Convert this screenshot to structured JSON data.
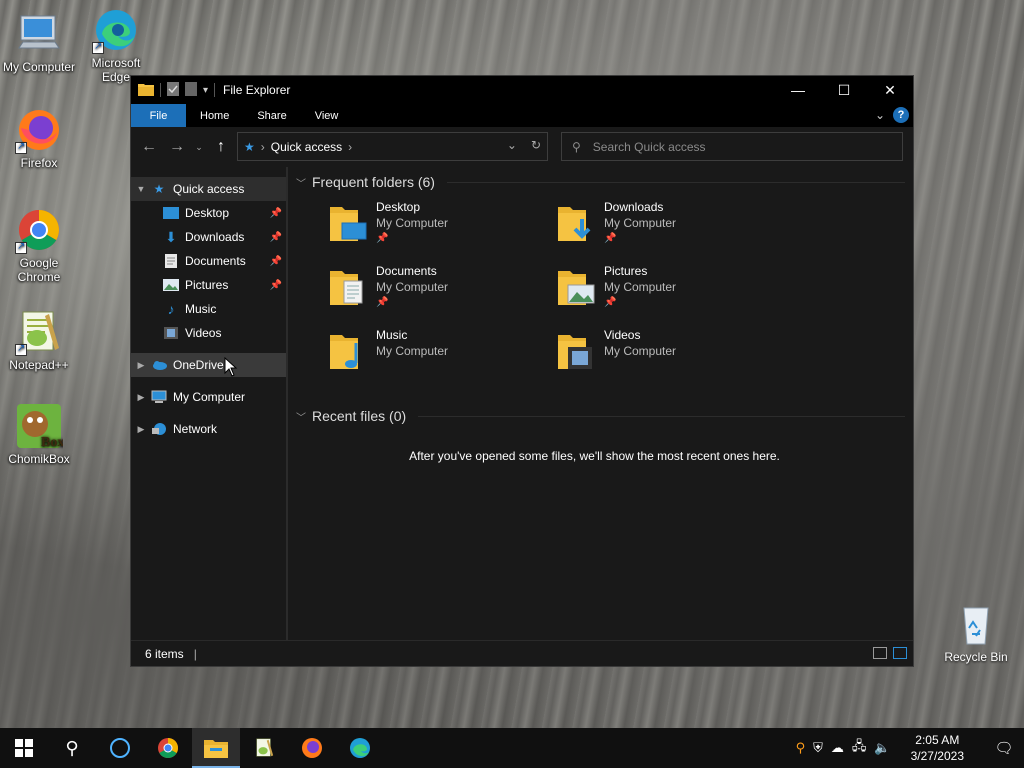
{
  "desktop": {
    "icons": [
      {
        "label": "My Computer"
      },
      {
        "label": "Microsoft Edge"
      },
      {
        "label": "Firefox"
      },
      {
        "label": "Google Chrome"
      },
      {
        "label": "Notepad++"
      },
      {
        "label": "ChomikBox"
      },
      {
        "label": "Recycle Bin"
      }
    ]
  },
  "window": {
    "title": "File Explorer",
    "ribbon_tabs": [
      "File",
      "Home",
      "Share",
      "View"
    ],
    "address": {
      "path": "Quick access"
    },
    "search": {
      "placeholder": "Search Quick access"
    },
    "sidebar": {
      "quick_access": "Quick access",
      "pinned": [
        {
          "label": "Desktop",
          "pinned": true
        },
        {
          "label": "Downloads",
          "pinned": true
        },
        {
          "label": "Documents",
          "pinned": true
        },
        {
          "label": "Pictures",
          "pinned": true
        },
        {
          "label": "Music",
          "pinned": false
        },
        {
          "label": "Videos",
          "pinned": false
        }
      ],
      "onedrive": "OneDrive",
      "my_computer": "My Computer",
      "network": "Network"
    },
    "frequent": {
      "header": "Frequent folders (6)",
      "folders": [
        {
          "name": "Desktop",
          "location": "My Computer",
          "pinned": true
        },
        {
          "name": "Downloads",
          "location": "My Computer",
          "pinned": true
        },
        {
          "name": "Documents",
          "location": "My Computer",
          "pinned": true
        },
        {
          "name": "Pictures",
          "location": "My Computer",
          "pinned": true
        },
        {
          "name": "Music",
          "location": "My Computer",
          "pinned": false
        },
        {
          "name": "Videos",
          "location": "My Computer",
          "pinned": false
        }
      ]
    },
    "recent": {
      "header": "Recent files (0)",
      "empty_message": "After you've opened some files, we'll show the most recent ones here."
    },
    "status": {
      "items": "6 items"
    }
  },
  "taskbar": {
    "clock_time": "2:05 AM",
    "clock_date": "3/27/2023"
  },
  "colors": {
    "accent": "#1c6fb8",
    "window_bg": "#191919",
    "folder_yellow": "#f5c342"
  }
}
